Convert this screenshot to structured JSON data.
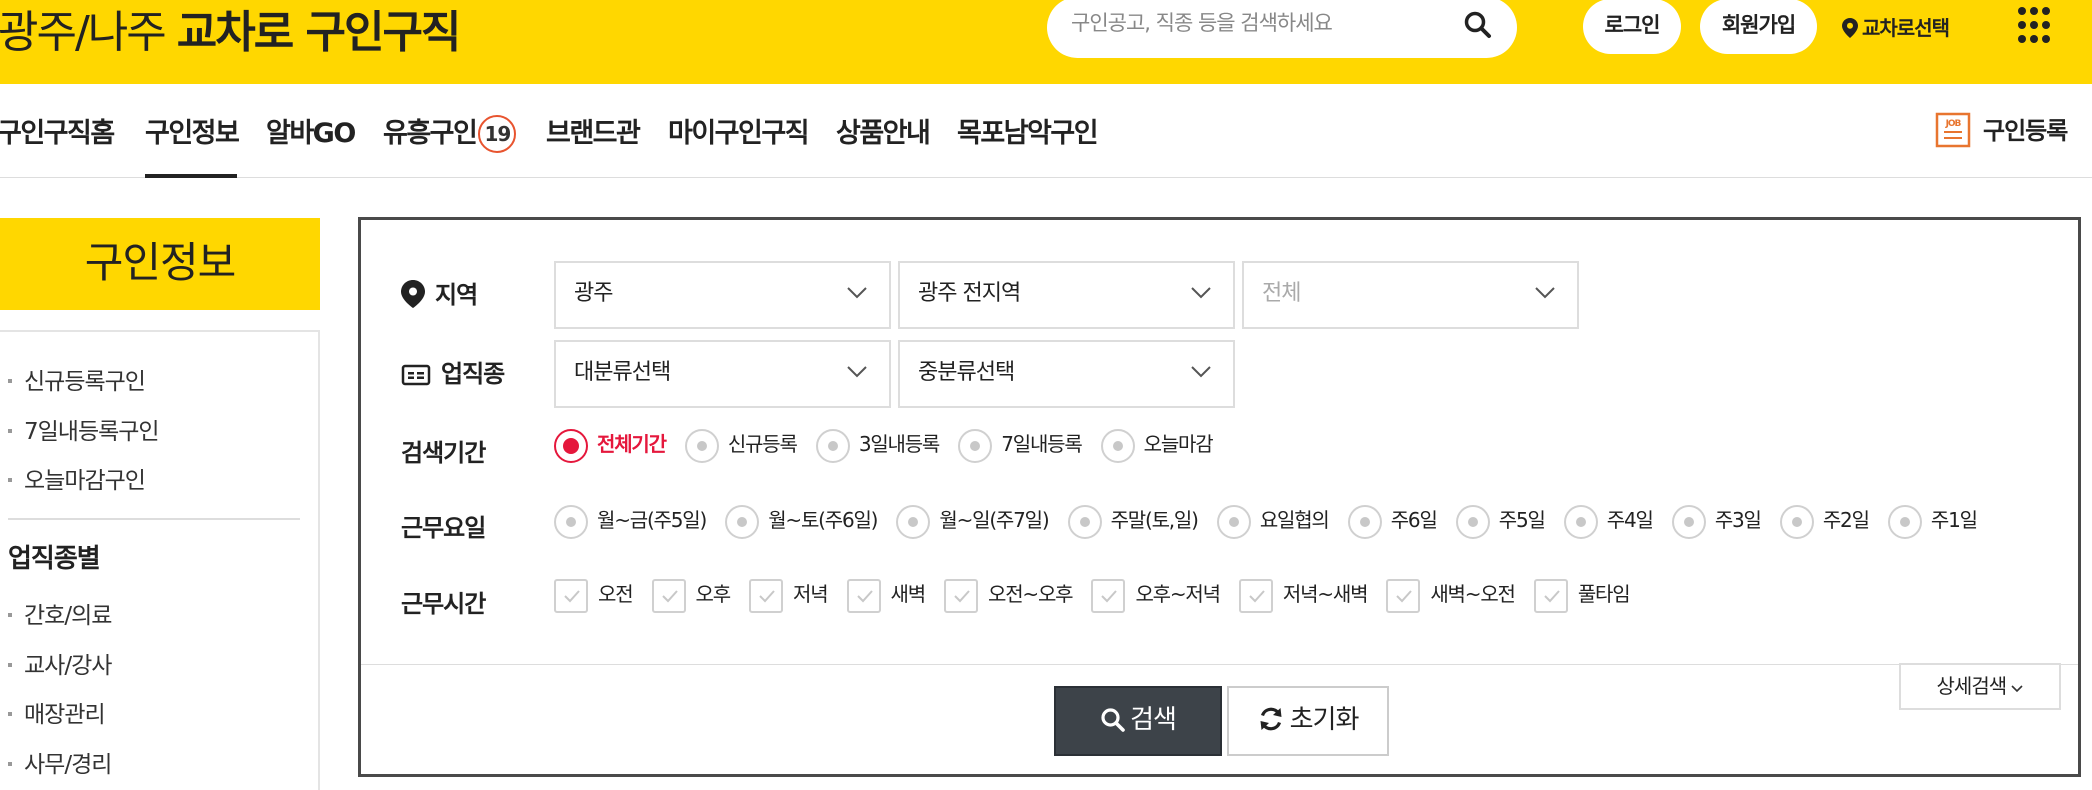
{
  "header": {
    "logo_region": "광주/나주 ",
    "logo_brand": "교차로 구인구직",
    "search_placeholder": "구인공고, 직종 등을 검색하세요",
    "login": "로그인",
    "signup": "회원가입",
    "region_select": "교차로선택"
  },
  "nav": {
    "items": [
      "구인구직홈",
      "구인정보",
      "알바GO",
      "유흥구인",
      "브랜드관",
      "마이구인구직",
      "상품안내",
      "목포남악구인"
    ],
    "adult_badge": "19",
    "active": "구인정보",
    "register": "구인등록",
    "job_icon_text": "JOB"
  },
  "sidebar": {
    "title": "구인정보",
    "quick_links": [
      "신규등록구인",
      "7일내등록구인",
      "오늘마감구인"
    ],
    "category_title": "업직종별",
    "categories": [
      "간호/의료",
      "교사/강사",
      "매장관리",
      "사무/경리"
    ]
  },
  "search_panel": {
    "region_label": "지역",
    "region_selects": [
      "광주",
      "광주 전지역",
      "전체"
    ],
    "job_label": "업직종",
    "job_selects": [
      "대분류선택",
      "중분류선택"
    ],
    "period_label": "검색기간",
    "period_options": [
      "전체기간",
      "신규등록",
      "3일내등록",
      "7일내등록",
      "오늘마감"
    ],
    "period_selected": "전체기간",
    "workday_label": "근무요일",
    "workday_options": [
      "월~금(주5일)",
      "월~토(주6일)",
      "월~일(주7일)",
      "주말(토,일)",
      "요일협의",
      "주6일",
      "주5일",
      "주4일",
      "주3일",
      "주2일",
      "주1일"
    ],
    "worktime_label": "근무시간",
    "worktime_options": [
      "오전",
      "오후",
      "저녁",
      "새벽",
      "오전~오후",
      "오후~저녁",
      "저녁~새벽",
      "새벽~오전",
      "풀타임"
    ],
    "search_button": "검색",
    "reset_button": "초기화",
    "detail_button": "상세검색"
  },
  "colors": {
    "brand_yellow": "#FFD700",
    "accent_red": "#e5173c",
    "badge_orange": "#e8542f",
    "dark_button": "#3d4349"
  }
}
